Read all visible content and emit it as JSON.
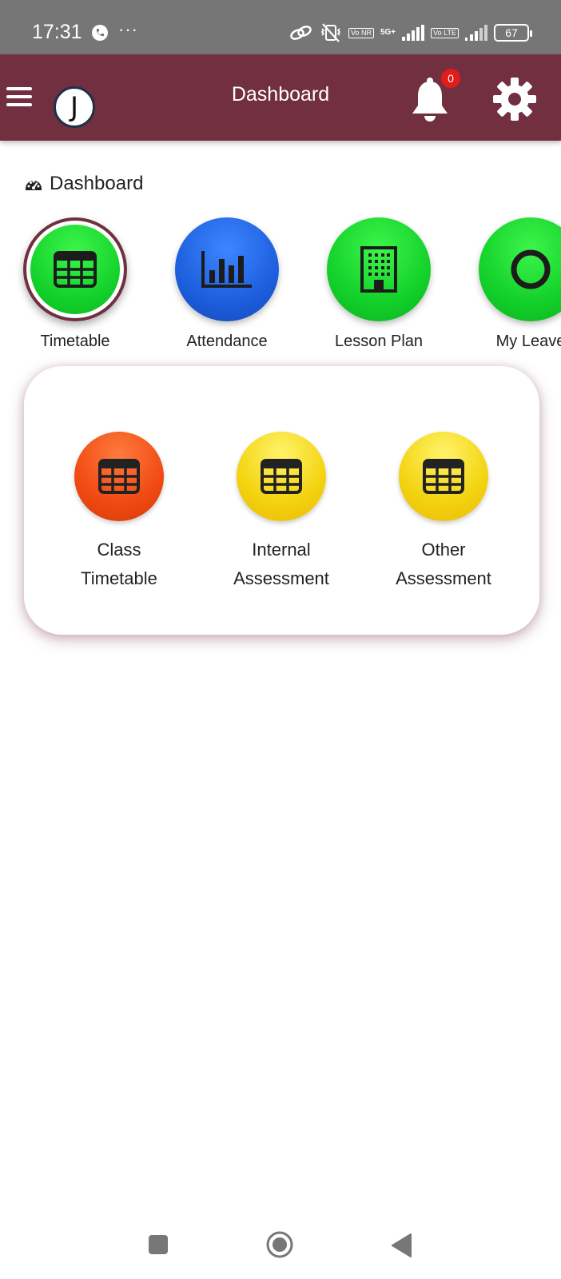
{
  "status_bar": {
    "time": "17:31",
    "dots": "···",
    "vonr": "Vo NR",
    "network": "5G+",
    "volte": "Vo LTE",
    "battery": "67"
  },
  "app_bar": {
    "title": "Dashboard",
    "avatar_letter": "J",
    "notification_count": "0",
    "color": "#722f40"
  },
  "page": {
    "heading": "Dashboard"
  },
  "menu": [
    {
      "label": "Timetable",
      "icon": "table-icon",
      "color": "green",
      "selected": true
    },
    {
      "label": "Attendance",
      "icon": "bar-chart-icon",
      "color": "blue",
      "selected": false
    },
    {
      "label": "Lesson Plan",
      "icon": "building-icon",
      "color": "green",
      "selected": false
    },
    {
      "label": "My Leave",
      "icon": "circle-icon",
      "color": "green",
      "selected": false
    }
  ],
  "submenu": [
    {
      "line1": "Class",
      "line2": "Timetable",
      "icon": "table-icon",
      "color": "orange"
    },
    {
      "line1": "Internal",
      "line2": "Assessment",
      "icon": "table-icon",
      "color": "yellow"
    },
    {
      "line1": "Other",
      "line2": "Assessment",
      "icon": "table-icon",
      "color": "yellow"
    }
  ]
}
